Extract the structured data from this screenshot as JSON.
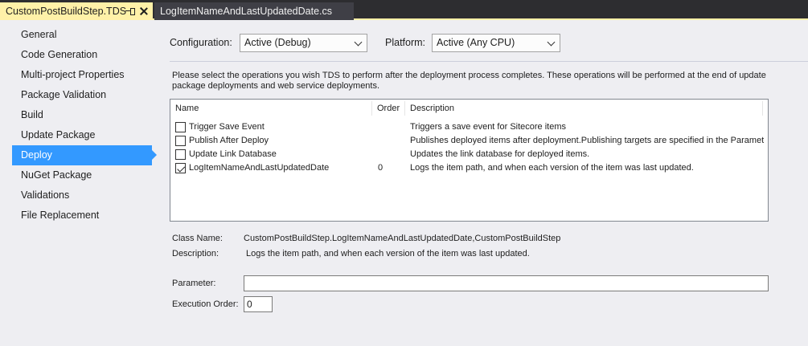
{
  "tabs": [
    {
      "label": "CustomPostBuildStep.TDS",
      "active": true
    },
    {
      "label": "LogItemNameAndLastUpdatedDate.cs",
      "active": false
    }
  ],
  "sidebar": {
    "items": [
      {
        "label": "General"
      },
      {
        "label": "Code Generation"
      },
      {
        "label": "Multi-project Properties"
      },
      {
        "label": "Package Validation"
      },
      {
        "label": "Build"
      },
      {
        "label": "Update Package"
      },
      {
        "label": "Deploy",
        "selected": true
      },
      {
        "label": "NuGet Package"
      },
      {
        "label": "Validations"
      },
      {
        "label": "File Replacement"
      }
    ]
  },
  "config": {
    "configuration_label": "Configuration:",
    "configuration_value": "Active (Debug)",
    "platform_label": "Platform:",
    "platform_value": "Active (Any CPU)"
  },
  "instructions": "Please select the operations you wish TDS to perform after the deployment process completes. These operations will be performed at the end of update package deployments and web service deployments.",
  "list": {
    "columns": {
      "name": "Name",
      "order": "Order",
      "description": "Description"
    },
    "rows": [
      {
        "name": "Trigger Save Event",
        "checked": false,
        "order": "",
        "description": "Triggers a save event for Sitecore items"
      },
      {
        "name": "Publish After Deploy",
        "checked": false,
        "order": "",
        "description": "Publishes deployed items after deployment.Publishing targets are specified in the Paramet..."
      },
      {
        "name": "Update Link Database",
        "checked": false,
        "order": "",
        "description": "Updates the link database for deployed items."
      },
      {
        "name": "LogItemNameAndLastUpdatedDate",
        "checked": true,
        "order": "0",
        "description": "Logs the item path, and when each version of the item was last updated."
      }
    ]
  },
  "details": {
    "class_name_label": "Class Name:",
    "class_name_value": "CustomPostBuildStep.LogItemNameAndLastUpdatedDate,CustomPostBuildStep",
    "description_label": "Description:",
    "description_value": "Logs the item path, and when each version of the item was last updated.",
    "parameter_label": "Parameter:",
    "parameter_value": "",
    "execution_order_label": "Execution Order:",
    "execution_order_value": "0"
  },
  "colors": {
    "active_tab": "#fff1a8",
    "selection": "#3399ff",
    "tab_strip": "#2d2d30",
    "background": "#eeeef2"
  }
}
